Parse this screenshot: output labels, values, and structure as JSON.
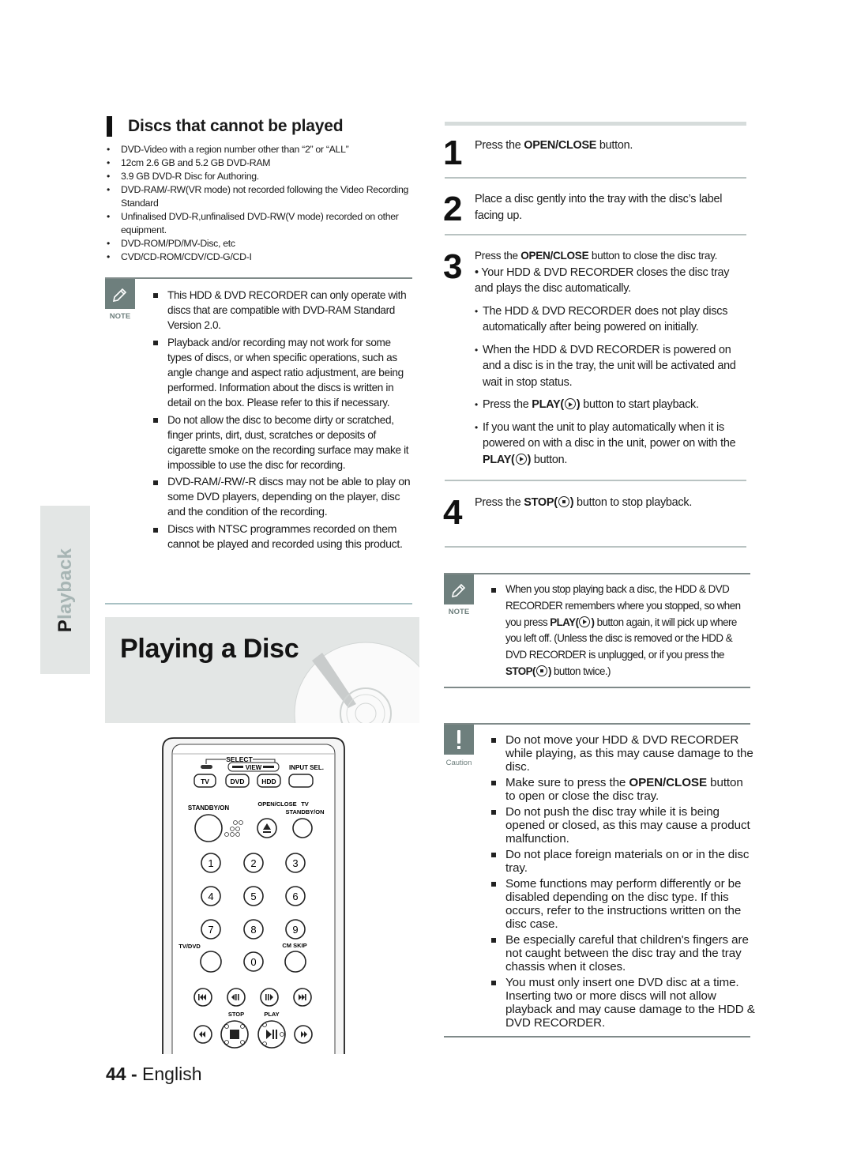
{
  "left_column": {
    "section_title": "Discs that cannot be played",
    "unplayable_discs": [
      "DVD-Video with a region number other than “2” or “ALL”",
      "12cm 2.6 GB and 5.2 GB DVD-RAM",
      "3.9 GB DVD-R Disc for Authoring.",
      "DVD-RAM/-RW(VR mode) not recorded following the Video Recording Standard",
      "Unfinalised DVD-R,unfinalised DVD-RW(V mode) recorded on other equipment.",
      "DVD-ROM/PD/MV-Disc, etc",
      "CVD/CD-ROM/CDV/CD-G/CD-I"
    ],
    "note": {
      "label": "NOTE",
      "icon": "pencil-icon",
      "items": [
        "This HDD & DVD RECORDER can only operate with discs that are compatible with DVD-RAM Standard Version 2.0.",
        "Playback and/or recording may not work for some types of discs, or when specific operations, such as angle change and aspect ratio adjustment, are being performed. Information about the discs is written in detail on the box. Please refer to this if necessary.",
        "Do not allow the disc to become dirty or scratched, finger prints, dirt, dust, scratches or deposits of cigarette smoke on the recording surface may make it impossible to use the disc for recording.",
        "DVD-RAM/-RW/-R discs may not be able to play on some DVD players, depending on the player, disc and the condition of the recording.",
        "Discs with NTSC programmes recorded on them cannot be played and recorded using this product."
      ]
    },
    "side_tab": {
      "first_letter": "P",
      "rest": "layback"
    },
    "banner_title": "Playing a Disc",
    "banner_icon": "disc-icon"
  },
  "remote": {
    "select_label": "SELECT",
    "view_label": "VIEW",
    "input_sel_label": "INPUT SEL.",
    "tv_button": "TV",
    "dvd_button": "DVD",
    "hdd_button": "HDD",
    "standby_label": "STANDBY/ON",
    "open_close_label": "OPEN/CLOSE",
    "tv_label": "TV",
    "tv_standby_label": "STANDBY/ON",
    "digits": [
      "1",
      "2",
      "3",
      "4",
      "5",
      "6",
      "7",
      "8",
      "9"
    ],
    "zero": "0",
    "tv_dvd_label": "TV/DVD",
    "cm_skip_label": "CM SKIP",
    "stop_label": "STOP",
    "play_label": "PLAY"
  },
  "footer": {
    "page_number": "44",
    "separator": "-",
    "language": "English"
  },
  "steps": [
    {
      "number": "1",
      "pre": "Press the ",
      "bold": "OPEN/CLOSE",
      "post": " button."
    },
    {
      "number": "2",
      "text": "Place a disc gently into the tray with the disc’s label facing up."
    },
    {
      "number": "3",
      "pre": "Press the ",
      "bold": "OPEN/CLOSE",
      "post": " button to close the disc tray.",
      "first_bullet": "Your HDD & DVD RECORDER closes the disc tray and plays the disc automatically.",
      "bullets": [
        "The HDD & DVD RECORDER does not play discs automatically after being powered on initially.",
        "When the HDD & DVD RECORDER is powered on and a disc is in the tray, the unit will be activated and wait in stop status."
      ],
      "play_bullet": {
        "pre": "Press the ",
        "bold": "PLAY(",
        "bold_end": ")",
        "post": " button to start playback."
      },
      "auto_bullet": {
        "pre": "If you want the unit to play automatically when it is powered on with a disc in the unit, power on with the ",
        "bold": "PLAY(",
        "bold_end": ")",
        "post": " button."
      }
    },
    {
      "number": "4",
      "pre": "Press the ",
      "bold": "STOP(",
      "bold_end": ")",
      "post": " button to stop playback."
    }
  ],
  "right_note": {
    "label": "NOTE",
    "icon": "pencil-icon",
    "t1": "When you stop playing back a disc, the HDD & DVD RECORDER remembers where you stopped, so when you press ",
    "b1": "PLAY(",
    "b1_end": ")",
    "t2": " button again, it will pick up where you left off. (Unless the disc is removed or the HDD & DVD RECORDER is unplugged, or if you press the ",
    "b2": "STOP(",
    "b2_end": ")",
    "t3": " button twice.)"
  },
  "caution": {
    "label": "Caution",
    "icon": "exclamation-icon",
    "item1": "Do not move your HDD & DVD RECORDER while playing, as this may cause damage to the disc.",
    "item2_pre": "Make sure to press the ",
    "item2_bold": "OPEN/CLOSE",
    "item2_post": " button to open or close the disc tray.",
    "items": [
      "Do not push the disc tray while it is being opened or closed, as this may cause a product malfunction.",
      "Do not place foreign materials on or in the disc tray.",
      "Some functions may perform differently or be disabled depending on the disc type. If this occurs, refer to the instructions written on the disc case.",
      "Be especially careful that children's fingers are not caught between the disc tray and the tray chassis when it closes.",
      "You must only insert one DVD disc at a time. Inserting two or more discs will not allow playback and may cause damage to the HDD & DVD RECORDER."
    ]
  }
}
